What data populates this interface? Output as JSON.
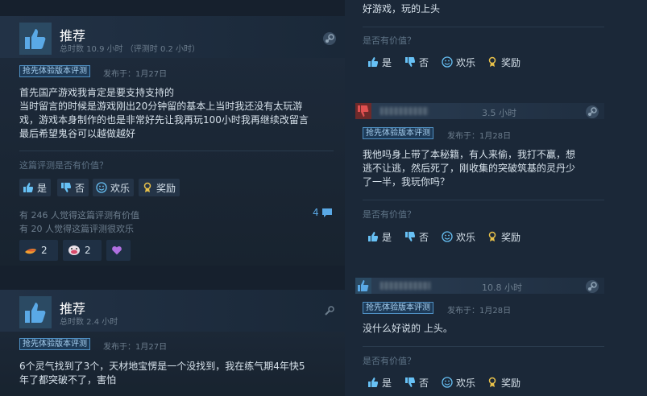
{
  "left": {
    "reviews": [
      {
        "verdict": "推荐",
        "hours": "总时数 10.9 小时 （评测时 0.2 小时）",
        "tag": "抢先体验版本评测",
        "posted": "发布于：1月27日",
        "text": [
          "首先国产游戏我肯定是要支持支持的",
          "当时留言的时候是游戏刚出20分钟留的基本上当时我还没有太玩游",
          "戏，游戏本身制作的也是非常好先让我再玩100小时我再继续改留言",
          "最后希望鬼谷可以越做越好"
        ],
        "helpful_q": "这篇评测是否有价值？",
        "btn_yes": "是",
        "btn_no": "否",
        "btn_funny": "欢乐",
        "btn_award": "奖励",
        "stat_helpful": "有 246 人觉得这篇评测有价值",
        "stat_funny": "有 20 人觉得这篇评测很欢乐",
        "comments": "4",
        "award_1": "2",
        "award_2": "2"
      },
      {
        "verdict": "推荐",
        "hours": "总时数 2.4 小时",
        "tag": "抢先体验版本评测",
        "posted": "发布于：1月27日",
        "text": [
          "6个灵气找到了3个，天材地宝愣是一个没找到，我在练气期4年快5",
          "年了都突破不了，害怕"
        ]
      }
    ]
  },
  "right": {
    "top_partial": {
      "text": "好游戏，玩的上头",
      "helpful_q": "是否有价值？",
      "btn_yes": "是",
      "btn_no": "否",
      "btn_funny": "欢乐",
      "btn_award": "奖励"
    },
    "comments": [
      {
        "hours": "3.5 小时",
        "tag": "抢先体验版本评测",
        "posted": "发布于：1月28日",
        "text": [
          "我他吗身上带了本秘籍，有人来偷，我打不赢，想",
          "逃不让逃，然后死了，刚收集的突破筑基的灵丹少",
          "了一半，我玩你吗？"
        ],
        "helpful_q": "是否有价值？",
        "btn_yes": "是",
        "btn_no": "否",
        "btn_funny": "欢乐",
        "btn_award": "奖励"
      },
      {
        "hours": "10.8 小时",
        "tag": "抢先体验版本评测",
        "posted": "发布于：1月28日",
        "text": [
          "没什么好说的 上头。"
        ],
        "helpful_q": "是否有价值？",
        "btn_yes": "是",
        "btn_no": "否",
        "btn_funny": "欢乐",
        "btn_award": "奖励"
      }
    ]
  },
  "colors": {
    "background": "#1b2838",
    "accent_blue": "#5aa9e6",
    "thumb_up_bg": "#2b4a63",
    "thumb_down_bg": "#6e2a2a",
    "tag_border": "#4f8fc2"
  }
}
